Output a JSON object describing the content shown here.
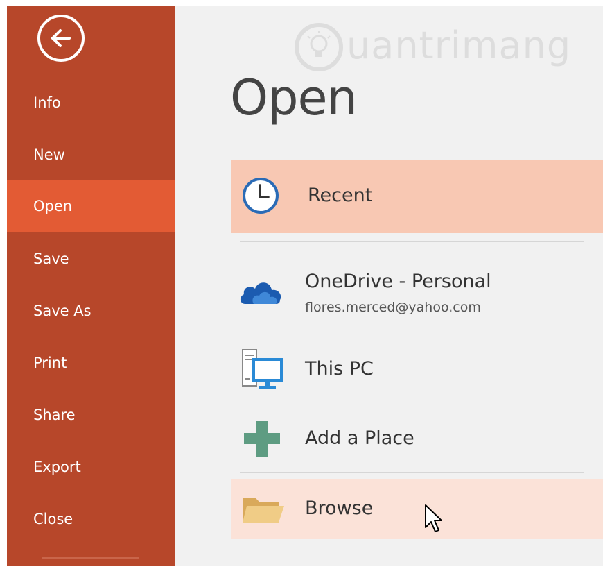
{
  "sidebar": {
    "items": [
      {
        "label": "Info"
      },
      {
        "label": "New"
      },
      {
        "label": "Open"
      },
      {
        "label": "Save"
      },
      {
        "label": "Save As"
      },
      {
        "label": "Print"
      },
      {
        "label": "Share"
      },
      {
        "label": "Export"
      },
      {
        "label": "Close"
      }
    ],
    "selected": "Open"
  },
  "main": {
    "title": "Open",
    "watermark": "uantrimang",
    "places": {
      "recent": {
        "label": "Recent",
        "icon": "clock-icon"
      },
      "onedrive": {
        "label": "OneDrive - Personal",
        "account": "flores.merced@yahoo.com",
        "icon": "cloud-icon"
      },
      "this_pc": {
        "label": "This PC",
        "icon": "computer-icon"
      },
      "add_place": {
        "label": "Add a Place",
        "icon": "plus-icon"
      },
      "browse": {
        "label": "Browse",
        "icon": "folder-icon"
      }
    }
  },
  "colors": {
    "sidebar": "#b7472a",
    "sidebar_selected": "#e35b34",
    "recent_highlight": "#f8c8b3",
    "browse_highlight": "#fbe2d8",
    "main_bg": "#f1f1f1",
    "onedrive_blue": "#1b5bb0",
    "pc_blue": "#2a8ad6",
    "plus_green": "#5e9c82",
    "folder_tan": "#e8c17a"
  }
}
